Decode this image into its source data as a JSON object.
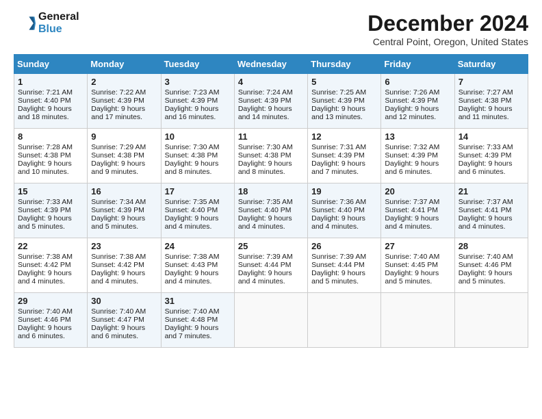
{
  "header": {
    "logo_line1": "General",
    "logo_line2": "Blue",
    "month_title": "December 2024",
    "location": "Central Point, Oregon, United States"
  },
  "days_of_week": [
    "Sunday",
    "Monday",
    "Tuesday",
    "Wednesday",
    "Thursday",
    "Friday",
    "Saturday"
  ],
  "weeks": [
    [
      {
        "day": "1",
        "sunrise": "Sunrise: 7:21 AM",
        "sunset": "Sunset: 4:40 PM",
        "daylight": "Daylight: 9 hours and 18 minutes."
      },
      {
        "day": "2",
        "sunrise": "Sunrise: 7:22 AM",
        "sunset": "Sunset: 4:39 PM",
        "daylight": "Daylight: 9 hours and 17 minutes."
      },
      {
        "day": "3",
        "sunrise": "Sunrise: 7:23 AM",
        "sunset": "Sunset: 4:39 PM",
        "daylight": "Daylight: 9 hours and 16 minutes."
      },
      {
        "day": "4",
        "sunrise": "Sunrise: 7:24 AM",
        "sunset": "Sunset: 4:39 PM",
        "daylight": "Daylight: 9 hours and 14 minutes."
      },
      {
        "day": "5",
        "sunrise": "Sunrise: 7:25 AM",
        "sunset": "Sunset: 4:39 PM",
        "daylight": "Daylight: 9 hours and 13 minutes."
      },
      {
        "day": "6",
        "sunrise": "Sunrise: 7:26 AM",
        "sunset": "Sunset: 4:39 PM",
        "daylight": "Daylight: 9 hours and 12 minutes."
      },
      {
        "day": "7",
        "sunrise": "Sunrise: 7:27 AM",
        "sunset": "Sunset: 4:38 PM",
        "daylight": "Daylight: 9 hours and 11 minutes."
      }
    ],
    [
      {
        "day": "8",
        "sunrise": "Sunrise: 7:28 AM",
        "sunset": "Sunset: 4:38 PM",
        "daylight": "Daylight: 9 hours and 10 minutes."
      },
      {
        "day": "9",
        "sunrise": "Sunrise: 7:29 AM",
        "sunset": "Sunset: 4:38 PM",
        "daylight": "Daylight: 9 hours and 9 minutes."
      },
      {
        "day": "10",
        "sunrise": "Sunrise: 7:30 AM",
        "sunset": "Sunset: 4:38 PM",
        "daylight": "Daylight: 9 hours and 8 minutes."
      },
      {
        "day": "11",
        "sunrise": "Sunrise: 7:30 AM",
        "sunset": "Sunset: 4:38 PM",
        "daylight": "Daylight: 9 hours and 8 minutes."
      },
      {
        "day": "12",
        "sunrise": "Sunrise: 7:31 AM",
        "sunset": "Sunset: 4:39 PM",
        "daylight": "Daylight: 9 hours and 7 minutes."
      },
      {
        "day": "13",
        "sunrise": "Sunrise: 7:32 AM",
        "sunset": "Sunset: 4:39 PM",
        "daylight": "Daylight: 9 hours and 6 minutes."
      },
      {
        "day": "14",
        "sunrise": "Sunrise: 7:33 AM",
        "sunset": "Sunset: 4:39 PM",
        "daylight": "Daylight: 9 hours and 6 minutes."
      }
    ],
    [
      {
        "day": "15",
        "sunrise": "Sunrise: 7:33 AM",
        "sunset": "Sunset: 4:39 PM",
        "daylight": "Daylight: 9 hours and 5 minutes."
      },
      {
        "day": "16",
        "sunrise": "Sunrise: 7:34 AM",
        "sunset": "Sunset: 4:39 PM",
        "daylight": "Daylight: 9 hours and 5 minutes."
      },
      {
        "day": "17",
        "sunrise": "Sunrise: 7:35 AM",
        "sunset": "Sunset: 4:40 PM",
        "daylight": "Daylight: 9 hours and 4 minutes."
      },
      {
        "day": "18",
        "sunrise": "Sunrise: 7:35 AM",
        "sunset": "Sunset: 4:40 PM",
        "daylight": "Daylight: 9 hours and 4 minutes."
      },
      {
        "day": "19",
        "sunrise": "Sunrise: 7:36 AM",
        "sunset": "Sunset: 4:40 PM",
        "daylight": "Daylight: 9 hours and 4 minutes."
      },
      {
        "day": "20",
        "sunrise": "Sunrise: 7:37 AM",
        "sunset": "Sunset: 4:41 PM",
        "daylight": "Daylight: 9 hours and 4 minutes."
      },
      {
        "day": "21",
        "sunrise": "Sunrise: 7:37 AM",
        "sunset": "Sunset: 4:41 PM",
        "daylight": "Daylight: 9 hours and 4 minutes."
      }
    ],
    [
      {
        "day": "22",
        "sunrise": "Sunrise: 7:38 AM",
        "sunset": "Sunset: 4:42 PM",
        "daylight": "Daylight: 9 hours and 4 minutes."
      },
      {
        "day": "23",
        "sunrise": "Sunrise: 7:38 AM",
        "sunset": "Sunset: 4:42 PM",
        "daylight": "Daylight: 9 hours and 4 minutes."
      },
      {
        "day": "24",
        "sunrise": "Sunrise: 7:38 AM",
        "sunset": "Sunset: 4:43 PM",
        "daylight": "Daylight: 9 hours and 4 minutes."
      },
      {
        "day": "25",
        "sunrise": "Sunrise: 7:39 AM",
        "sunset": "Sunset: 4:44 PM",
        "daylight": "Daylight: 9 hours and 4 minutes."
      },
      {
        "day": "26",
        "sunrise": "Sunrise: 7:39 AM",
        "sunset": "Sunset: 4:44 PM",
        "daylight": "Daylight: 9 hours and 5 minutes."
      },
      {
        "day": "27",
        "sunrise": "Sunrise: 7:40 AM",
        "sunset": "Sunset: 4:45 PM",
        "daylight": "Daylight: 9 hours and 5 minutes."
      },
      {
        "day": "28",
        "sunrise": "Sunrise: 7:40 AM",
        "sunset": "Sunset: 4:46 PM",
        "daylight": "Daylight: 9 hours and 5 minutes."
      }
    ],
    [
      {
        "day": "29",
        "sunrise": "Sunrise: 7:40 AM",
        "sunset": "Sunset: 4:46 PM",
        "daylight": "Daylight: 9 hours and 6 minutes."
      },
      {
        "day": "30",
        "sunrise": "Sunrise: 7:40 AM",
        "sunset": "Sunset: 4:47 PM",
        "daylight": "Daylight: 9 hours and 6 minutes."
      },
      {
        "day": "31",
        "sunrise": "Sunrise: 7:40 AM",
        "sunset": "Sunset: 4:48 PM",
        "daylight": "Daylight: 9 hours and 7 minutes."
      },
      null,
      null,
      null,
      null
    ]
  ]
}
